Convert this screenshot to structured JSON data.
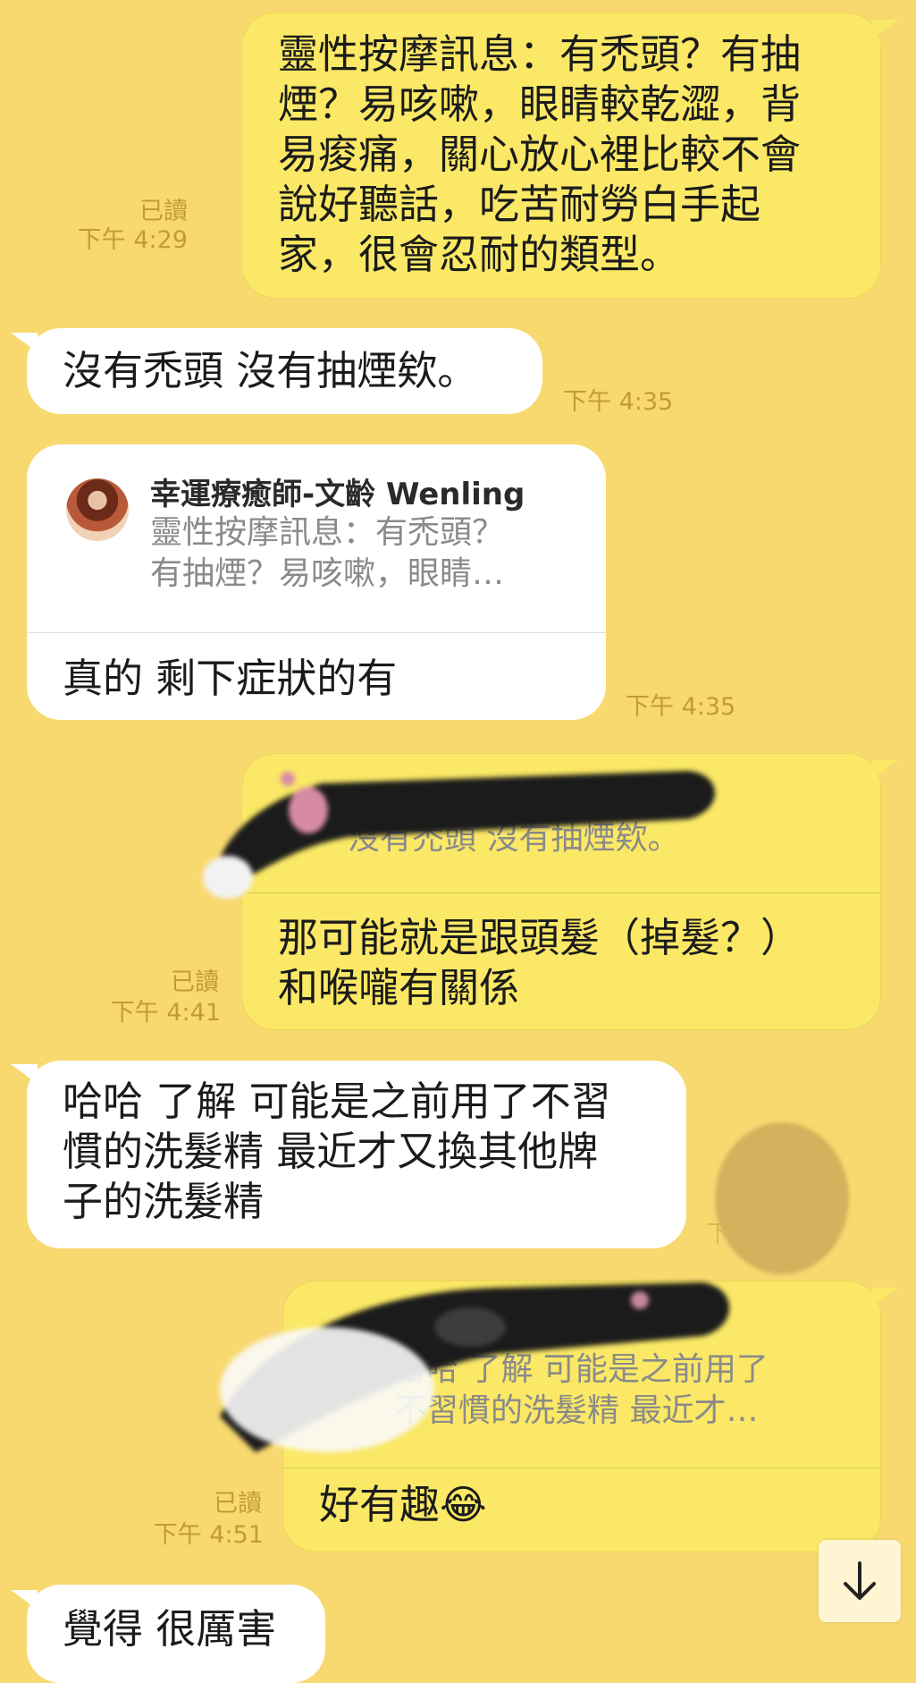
{
  "messages": [
    {
      "text": "靈性按摩訊息：有禿頭？有抽\n煙？易咳嗽，眼睛較乾澀，背\n易痠痛，關心放心裡比較不會\n說好聽話，吃苦耐勞白手起\n家，很會忍耐的類型。",
      "read": "已讀",
      "time": "下午 4:29"
    },
    {
      "text": "沒有禿頭 沒有抽煙欸。",
      "time": "下午 4:35"
    },
    {
      "quote_sender": "幸運療癒師-文齡 Wenling",
      "quote_text": "靈性按摩訊息：有禿頭？\n有抽煙？易咳嗽，眼睛…",
      "text": "真的 剩下症狀的有",
      "time": "下午 4:35"
    },
    {
      "quote_text": "沒有禿頭 沒有抽煙欸。",
      "text": "那可能就是跟頭髮（掉髮？）\n和喉嚨有關係",
      "read": "已讀",
      "time": "下午 4:41"
    },
    {
      "text": "哈哈 了解 可能是之前用了不習\n慣的洗髮精 最近才又換其他牌\n子的洗髮精",
      "time": "下午 4:51"
    },
    {
      "quote_text": "哈哈 了解 可能是之前用了\n不習慣的洗髮精 最近才…",
      "text": "好有趣😂",
      "read": "已讀",
      "time": "下午 4:51"
    },
    {
      "text": "覺得 很厲害"
    }
  ],
  "icons": {
    "scroll_down": "arrow-down-icon",
    "avatar": "avatar-image"
  },
  "colors": {
    "background": "#f8d970",
    "outgoing": "#fae866",
    "incoming": "#ffffff",
    "meta": "#c49a38"
  }
}
